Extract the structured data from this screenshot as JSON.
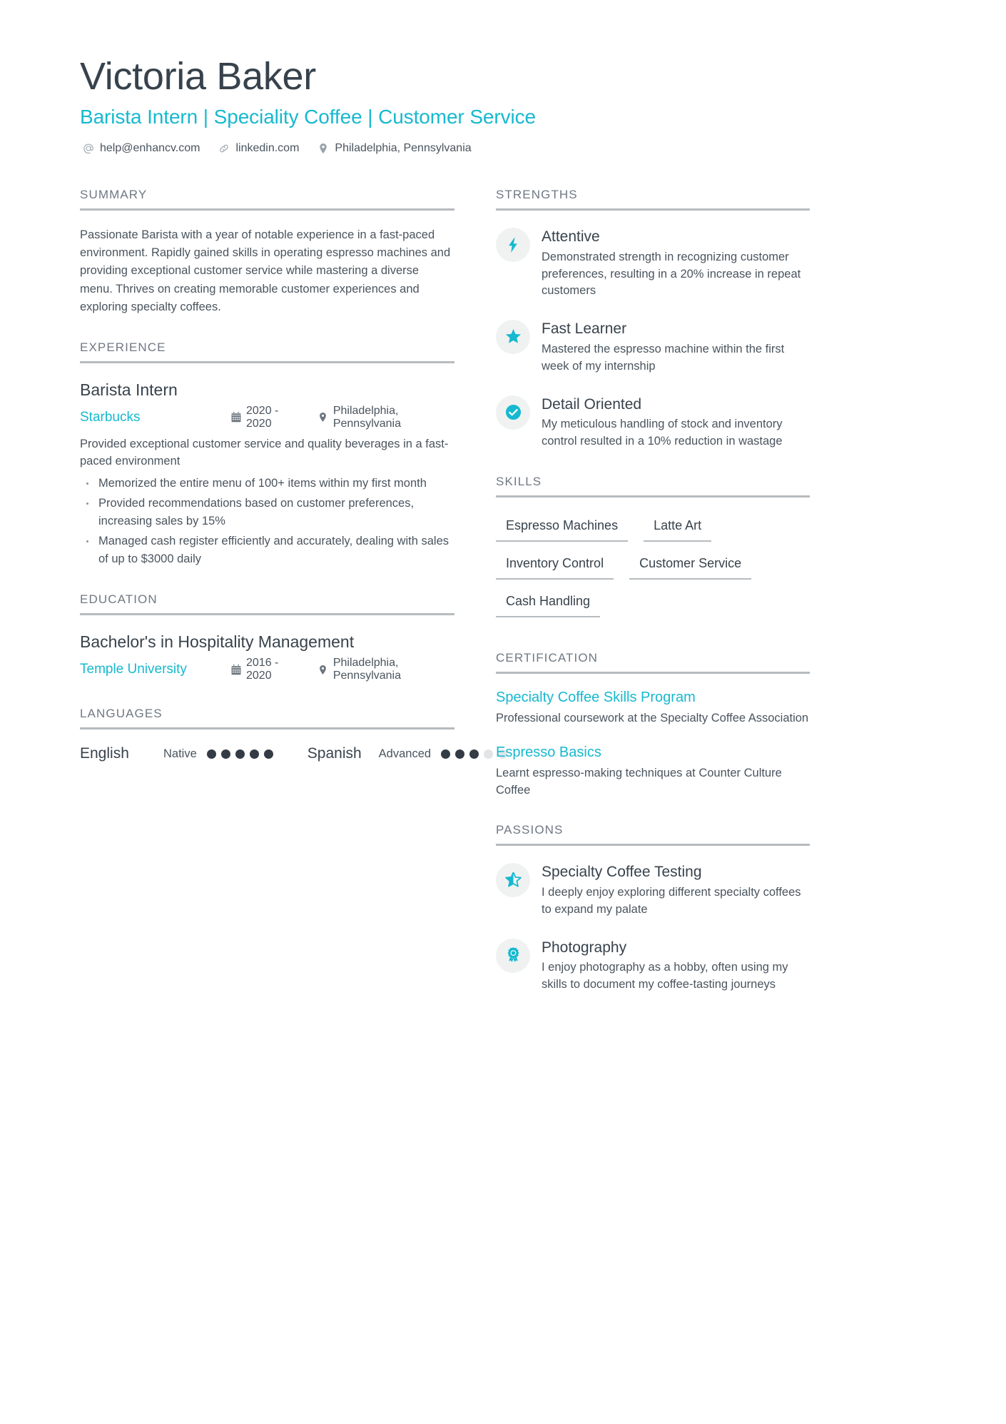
{
  "header": {
    "name": "Victoria Baker",
    "headline": "Barista Intern | Speciality Coffee | Customer Service",
    "contacts": [
      {
        "icon": "at-icon",
        "text": "help@enhancv.com"
      },
      {
        "icon": "link-icon",
        "text": "linkedin.com"
      },
      {
        "icon": "location-pin-icon",
        "text": "Philadelphia, Pennsylvania"
      }
    ]
  },
  "sections": {
    "summary_title": "SUMMARY",
    "experience_title": "EXPERIENCE",
    "education_title": "EDUCATION",
    "languages_title": "LANGUAGES",
    "strengths_title": "STRENGTHS",
    "skills_title": "SKILLS",
    "certification_title": "CERTIFICATION",
    "passions_title": "PASSIONS"
  },
  "summary": {
    "text": "Passionate Barista with a year of notable experience in a fast-paced environment. Rapidly gained skills in operating espresso machines and providing exceptional customer service while mastering a diverse menu. Thrives on creating memorable customer experiences and exploring specialty coffees."
  },
  "experience": [
    {
      "title": "Barista Intern",
      "organization": "Starbucks",
      "dates": "2020 - 2020",
      "location": "Philadelphia, Pennsylvania",
      "description": "Provided exceptional customer service and quality beverages in a fast-paced environment",
      "bullets": [
        "Memorized the entire menu of 100+ items within my first month",
        "Provided recommendations based on customer preferences, increasing sales by 15%",
        "Managed cash register efficiently and accurately, dealing with sales of up to $3000 daily"
      ]
    }
  ],
  "education": [
    {
      "title": "Bachelor's in Hospitality Management",
      "organization": "Temple University",
      "dates": "2016 - 2020",
      "location": "Philadelphia, Pennsylvania"
    }
  ],
  "languages": [
    {
      "name": "English",
      "level": "Native",
      "filled": 5,
      "total": 5
    },
    {
      "name": "Spanish",
      "level": "Advanced",
      "filled": 3,
      "total": 5
    }
  ],
  "strengths": [
    {
      "icon": "lightning-bolt-icon",
      "title": "Attentive",
      "description": "Demonstrated strength in recognizing customer preferences, resulting in a 20% increase in repeat customers"
    },
    {
      "icon": "star-icon",
      "title": "Fast Learner",
      "description": "Mastered the espresso machine within the first week of my internship"
    },
    {
      "icon": "check-circle-icon",
      "title": "Detail Oriented",
      "description": "My meticulous handling of stock and inventory control resulted in a 10% reduction in wastage"
    }
  ],
  "skills": [
    "Espresso Machines",
    "Latte Art",
    "Inventory Control",
    "Customer Service",
    "Cash Handling"
  ],
  "certifications": [
    {
      "title": "Specialty Coffee Skills Program",
      "description": "Professional coursework at the Specialty Coffee Association"
    },
    {
      "title": "Espresso Basics",
      "description": "Learnt espresso-making techniques at Counter Culture Coffee"
    }
  ],
  "passions": [
    {
      "icon": "half-star-icon",
      "title": "Specialty Coffee Testing",
      "description": "I deeply enjoy exploring different specialty coffees to expand my palate"
    },
    {
      "icon": "award-ribbon-icon",
      "title": "Photography",
      "description": "I enjoy photography as a hobby, often using my skills to document my coffee-tasting journeys"
    }
  ],
  "theme": {
    "accent": "#16b9cf",
    "heading": "#6f7883",
    "text": "#4a545e",
    "rule": "#b6bbbf"
  }
}
